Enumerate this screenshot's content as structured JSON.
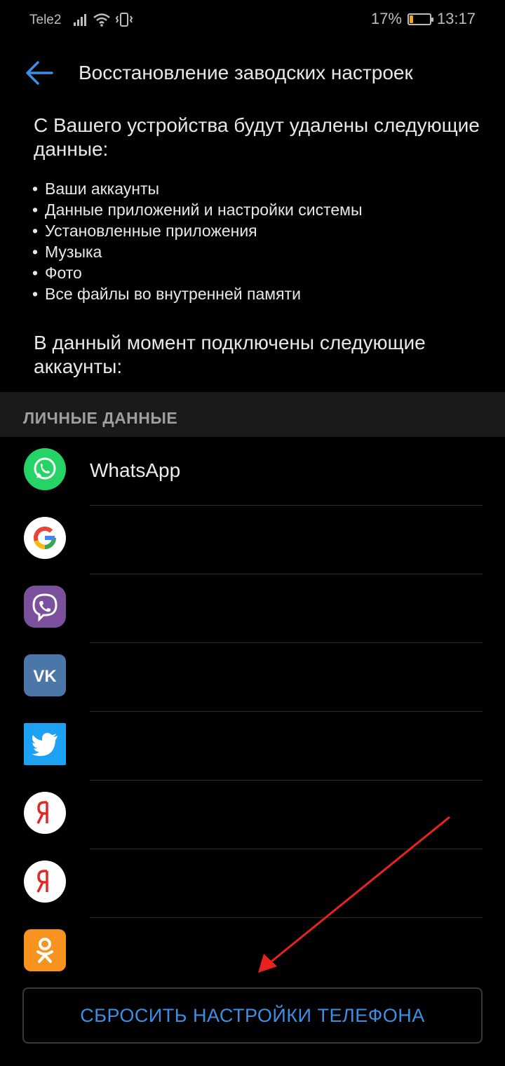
{
  "status_bar": {
    "carrier": "Tele2",
    "battery_percent": "17%",
    "time": "13:17",
    "battery_level": 0.17,
    "battery_color": "#f5a623"
  },
  "app_bar": {
    "back_icon": "arrow-left-icon",
    "title": "Восстановление заводских настроек"
  },
  "intro_text": "С Вашего устройства будут удалены следующие данные:",
  "bullets": [
    "Ваши аккаунты",
    "Данные приложений и настройки системы",
    "Установленные приложения",
    "Музыка",
    "Фото",
    "Все файлы во внутренней памяти"
  ],
  "accounts_text": "В данный момент подключены следующие аккаунты:",
  "section_header": "ЛИЧНЫЕ ДАННЫЕ",
  "accounts": [
    {
      "icon": "whatsapp-icon",
      "name": "WhatsApp",
      "color": "#25d366"
    },
    {
      "icon": "google-icon",
      "name": "",
      "color": "#ffffff"
    },
    {
      "icon": "viber-icon",
      "name": "",
      "color": "#7b519d"
    },
    {
      "icon": "vk-icon",
      "name": "",
      "color": "#4a76a8"
    },
    {
      "icon": "twitter-icon",
      "name": "",
      "color": "#1da1f2"
    },
    {
      "icon": "yandex-icon",
      "name": "",
      "color": "#ffffff"
    },
    {
      "icon": "yandex-icon",
      "name": "",
      "color": "#ffffff"
    },
    {
      "icon": "odnoklassniki-icon",
      "name": "",
      "color": "#f7931e"
    }
  ],
  "reset_button": "СБРОСИТЬ НАСТРОЙКИ ТЕЛЕФОНА",
  "colors": {
    "accent": "#3d8fe6",
    "annotation_arrow": "#e8231f"
  }
}
